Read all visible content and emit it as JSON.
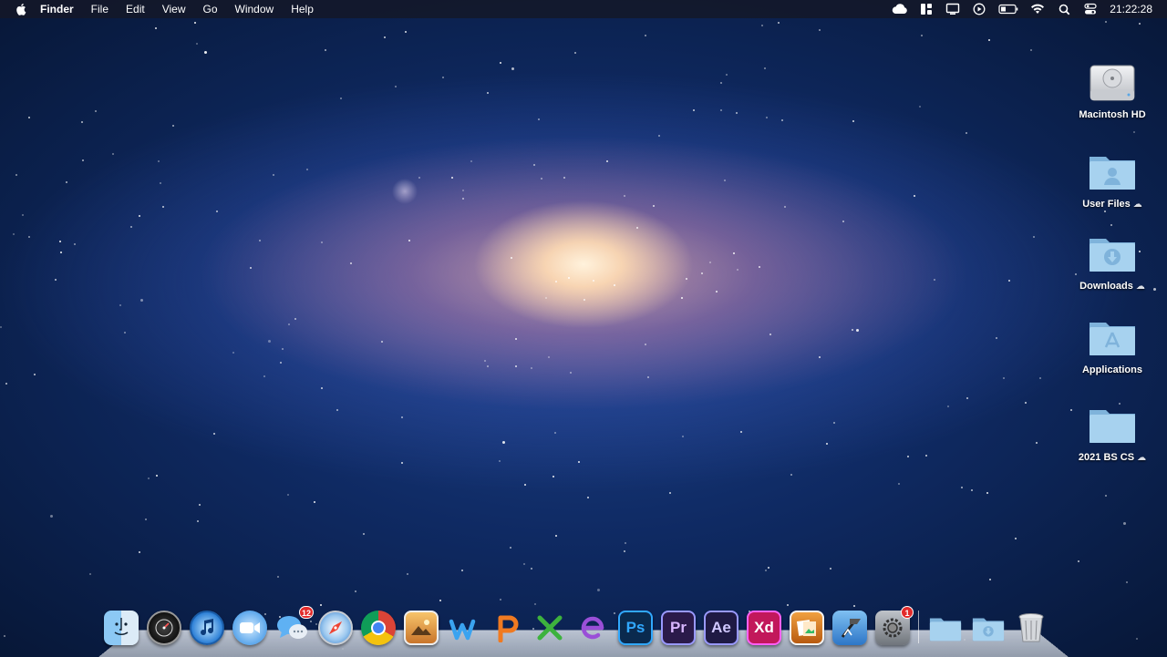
{
  "menubar": {
    "apple_icon": "apple-logo-icon",
    "app_name": "Finder",
    "items": [
      "File",
      "Edit",
      "View",
      "Go",
      "Window",
      "Help"
    ],
    "status_icons": [
      "icloud-icon",
      "layout-icon",
      "display-icon",
      "play-icon",
      "battery-icon",
      "wifi-icon",
      "search-icon",
      "control-center-icon"
    ],
    "clock": "21:22:28"
  },
  "desktop": {
    "icons": [
      {
        "label": "Macintosh HD",
        "icon": "hard-drive-icon"
      },
      {
        "label": "User Files",
        "icon": "user-folder-icon",
        "cloud": true
      },
      {
        "label": "Downloads",
        "icon": "downloads-folder-icon",
        "cloud": true
      },
      {
        "label": "Applications",
        "icon": "applications-folder-icon"
      },
      {
        "label": "2021 BS CS",
        "icon": "folder-icon",
        "cloud": true
      }
    ]
  },
  "dock": {
    "apps": [
      {
        "name": "finder",
        "icon": "finder-icon"
      },
      {
        "name": "dashboard",
        "icon": "dashboard-icon"
      },
      {
        "name": "itunes",
        "icon": "itunes-icon"
      },
      {
        "name": "facetime",
        "icon": "facetime-icon"
      },
      {
        "name": "messages",
        "icon": "messages-icon",
        "badge": "12"
      },
      {
        "name": "safari",
        "icon": "safari-icon"
      },
      {
        "name": "chrome",
        "icon": "chrome-icon"
      },
      {
        "name": "preview",
        "icon": "preview-icon"
      },
      {
        "name": "wps-writer",
        "icon": "wps-writer-icon"
      },
      {
        "name": "wps-presentation",
        "icon": "wps-presentation-icon"
      },
      {
        "name": "wps-spreadsheets",
        "icon": "wps-spreadsheets-icon"
      },
      {
        "name": "wps-pdf",
        "icon": "wps-pdf-icon"
      },
      {
        "name": "photoshop",
        "icon": "photoshop-icon",
        "text": "Ps"
      },
      {
        "name": "premiere-pro",
        "icon": "premiere-icon",
        "text": "Pr"
      },
      {
        "name": "after-effects",
        "icon": "after-effects-icon",
        "text": "Ae"
      },
      {
        "name": "adobe-xd",
        "icon": "xd-icon",
        "text": "Xd"
      },
      {
        "name": "image-viewer",
        "icon": "image-viewer-icon"
      },
      {
        "name": "xcode",
        "icon": "xcode-icon"
      },
      {
        "name": "system-preferences",
        "icon": "system-preferences-icon",
        "badge": "1"
      }
    ],
    "stacks": [
      {
        "name": "documents-stack",
        "icon": "folder-icon"
      },
      {
        "name": "downloads-stack",
        "icon": "downloads-folder-icon"
      },
      {
        "name": "trash",
        "icon": "trash-icon"
      }
    ]
  },
  "colors": {
    "menubar_bg": "#141828",
    "badge": "#e32b2b",
    "folder": "#9ec8e8",
    "photoshop": "#0a2a4e",
    "premiere": "#2b1a4a",
    "after_effects": "#1f1a44",
    "xd": "#470137"
  }
}
